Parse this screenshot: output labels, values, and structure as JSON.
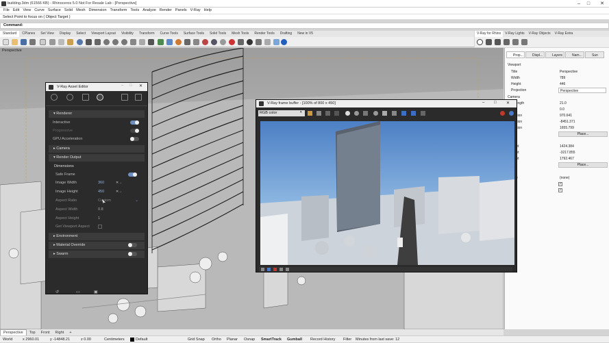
{
  "window": {
    "title": "building.3dm (61566 KB) - Rhinoceros 5.0 Not For Resale Lab - [Perspective]",
    "controls": [
      "–",
      "□",
      "✕"
    ]
  },
  "menu": [
    "File",
    "Edit",
    "View",
    "Curve",
    "Surface",
    "Solid",
    "Mesh",
    "Dimension",
    "Transform",
    "Tools",
    "Analyze",
    "Render",
    "Panels",
    "V-Ray",
    "Help"
  ],
  "command": {
    "history": "Select Point to focus on ( Object Target )",
    "prompt": "Command:"
  },
  "toolbar_tabs": [
    "Standard",
    "CPlanes",
    "Set View",
    "Display",
    "Select",
    "Viewport Layout",
    "Visibility",
    "Transform",
    "Curve Tools",
    "Surface Tools",
    "Solid Tools",
    "Mesh Tools",
    "Render Tools",
    "Drafting",
    "New in V5"
  ],
  "vray_tabs": [
    "V-Ray for Rhino",
    "V-Ray Lights",
    "V-Ray Objects",
    "V-Ray Extra"
  ],
  "viewport": {
    "label": "Perspective"
  },
  "properties": {
    "tabs": [
      "Prop...",
      "Displ...",
      "Layers",
      "Nam...",
      "Sun"
    ],
    "viewport_section": "Viewport",
    "rows": [
      {
        "k": "Title",
        "v": "Perspective"
      },
      {
        "k": "Width",
        "v": "789"
      },
      {
        "k": "Height",
        "v": "446"
      },
      {
        "k": "Projection",
        "v": "Perspective"
      }
    ],
    "camera_section": "Camera",
    "camera_rows": [
      {
        "k": "s Length",
        "v": "21.0"
      },
      {
        "k": "tion",
        "v": "0.0"
      },
      {
        "k": "ocation",
        "v": "970.641"
      },
      {
        "k": "ocation",
        "v": "-8451.371"
      },
      {
        "k": "ocation",
        "v": "1655.799"
      },
      {
        "k": "on",
        "v": ""
      }
    ],
    "target_rows": [
      {
        "k": "arget",
        "v": "1424.384"
      },
      {
        "k": "arget",
        "v": "-3217.855"
      },
      {
        "k": "arget",
        "v": "1792.467"
      },
      {
        "k": "on",
        "v": ""
      }
    ],
    "other_rows": [
      {
        "k": "ame",
        "v": "(none)"
      },
      {
        "k": "w",
        "v": ""
      },
      {
        "k": "",
        "v": ""
      }
    ],
    "place_label": "Place..."
  },
  "viewport_tabs": [
    "Perspective",
    "Top",
    "Front",
    "Right"
  ],
  "status": {
    "world": "World",
    "x": "x 2960.01",
    "y": "y -14848.21",
    "z": "z 0.00",
    "units": "Centimeters",
    "layer": "Default",
    "items": [
      "Grid Snap",
      "Ortho",
      "Planar",
      "Osnap",
      "SmartTrack",
      "Gumball",
      "Record History",
      "Filter"
    ],
    "save": "Minutes from last save: 12"
  },
  "asset_editor": {
    "title": "V-Ray Asset Editor",
    "renderer": "Renderer",
    "interactive": "Interactive",
    "progressive": "Progressive",
    "gpu": "GPU Acceleration",
    "camera": "Camera",
    "render_output": "Render Output",
    "dimensions": "Dimensions",
    "safe_frame": "Safe Frame",
    "image_width": "Image Width",
    "image_width_val": "360",
    "image_height": "Image Height",
    "image_height_val": "450",
    "aspect_ratio": "Aspect Ratio",
    "aspect_ratio_val": "Custom",
    "aspect_width": "Aspect Width",
    "aspect_width_val": "0.8",
    "aspect_height": "Aspect Height",
    "aspect_height_val": "1",
    "get_aspect": "Get Viewport Aspect",
    "environment": "Environment",
    "material_override": "Material Override",
    "swarm": "Swarm"
  },
  "frame_buffer": {
    "title": "V-Ray frame buffer - [100% of 800 x 450]",
    "channel": "RGB color"
  }
}
